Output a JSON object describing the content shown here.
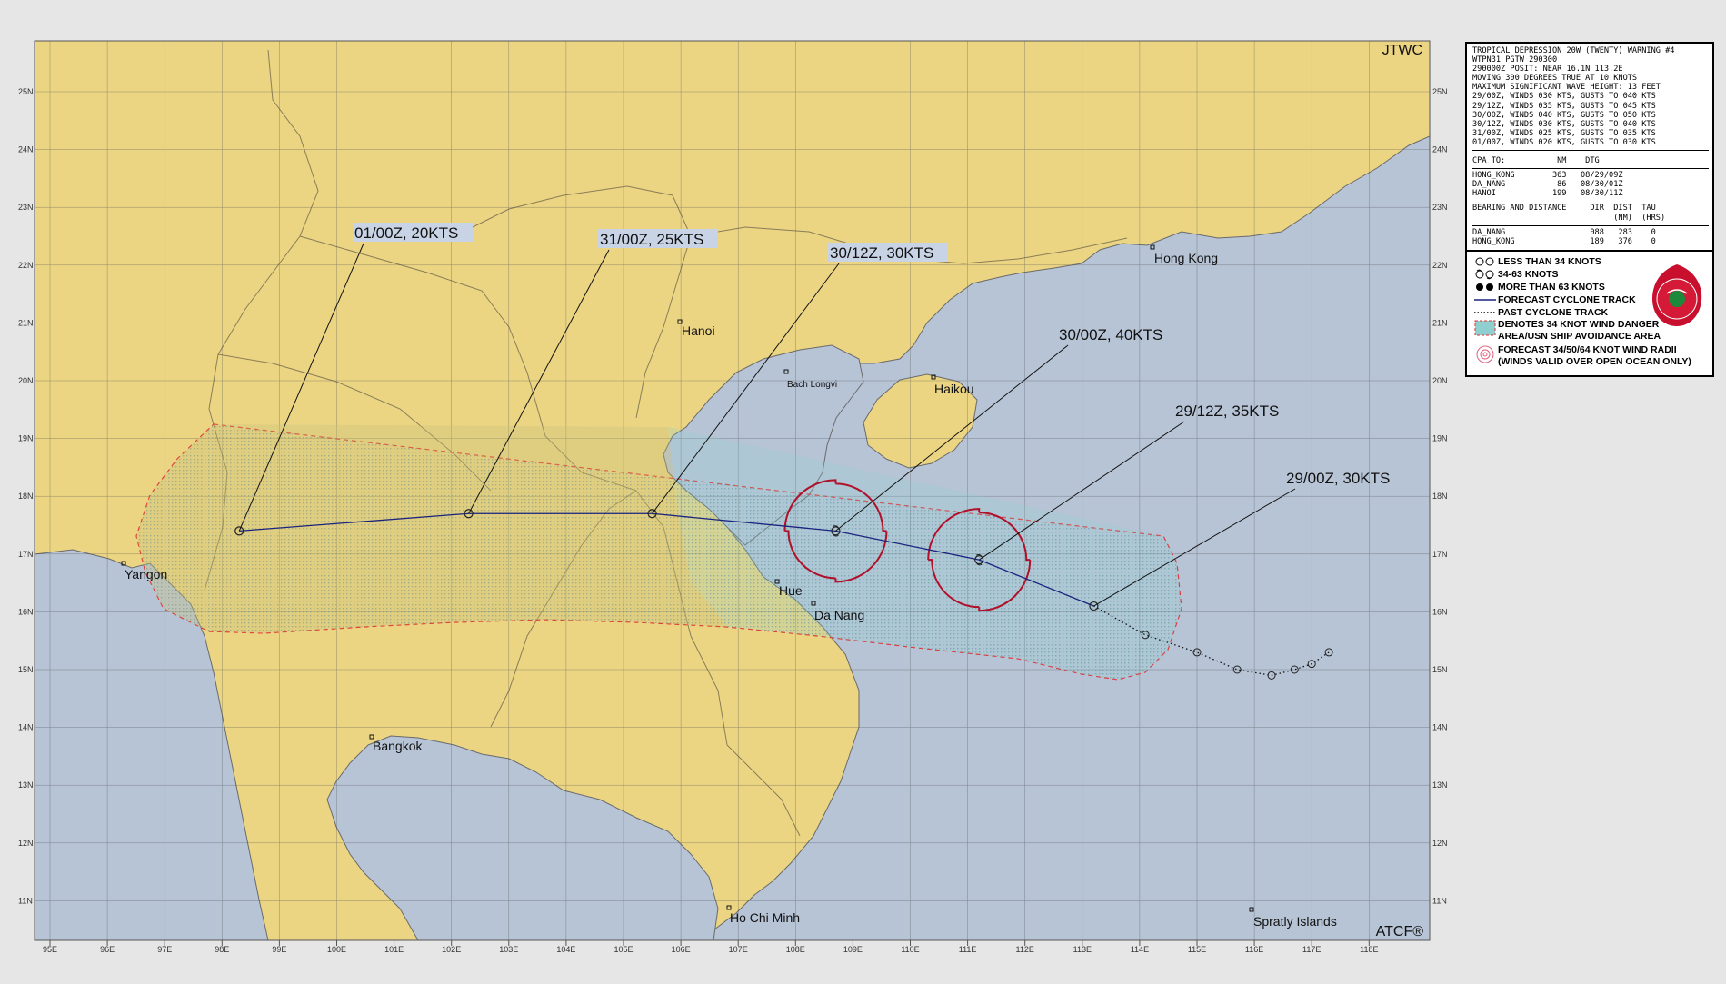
{
  "header": {
    "agency": "JTWC",
    "footer": "ATCF®"
  },
  "warning_text": {
    "lines": [
      "TROPICAL DEPRESSION 20W (TWENTY) WARNING #4",
      "WTPN31 PGTW 290300",
      "290000Z POSIT: NEAR 16.1N 113.2E",
      "MOVING 300 DEGREES TRUE AT 10 KNOTS",
      "MAXIMUM SIGNIFICANT WAVE HEIGHT: 13 FEET",
      "29/00Z, WINDS 030 KTS, GUSTS TO 040 KTS",
      "29/12Z, WINDS 035 KTS, GUSTS TO 045 KTS",
      "30/00Z, WINDS 040 KTS, GUSTS TO 050 KTS",
      "30/12Z, WINDS 030 KTS, GUSTS TO 040 KTS",
      "31/00Z, WINDS 025 KTS, GUSTS TO 035 KTS",
      "01/00Z, WINDS 020 KTS, GUSTS TO 030 KTS"
    ],
    "cpa_header": "CPA TO:           NM    DTG",
    "cpa_rows": [
      "HONG_KONG        363   08/29/09Z",
      "DA_NANG           86   08/30/01Z",
      "HANOI            199   08/30/11Z"
    ],
    "bd_header1": "BEARING AND DISTANCE     DIR  DIST  TAU",
    "bd_header2": "                              (NM)  (HRS)",
    "bd_rows": [
      "DA_NANG                  088   283    0",
      "HONG_KONG                189   376    0"
    ]
  },
  "legend": {
    "items": [
      "LESS THAN 34 KNOTS",
      "34-63 KNOTS",
      "MORE THAN 63 KNOTS",
      "FORECAST CYCLONE TRACK",
      "PAST CYCLONE TRACK",
      "DENOTES 34 KNOT WIND DANGER",
      "AREA/USN SHIP AVOIDANCE AREA",
      "FORECAST 34/50/64 KNOT WIND RADII",
      "(WINDS VALID OVER OPEN OCEAN ONLY)"
    ],
    "colors": {
      "track": "#1a237e",
      "danger_fill": "#8fcfcf",
      "danger_border": "#e03030",
      "radii": "#b0102a"
    }
  },
  "forecast_labels": [
    "29/00Z, 30KTS",
    "29/12Z, 35KTS",
    "30/00Z, 40KTS",
    "30/12Z, 30KTS",
    "31/00Z, 25KTS",
    "01/00Z, 20KTS"
  ],
  "track": {
    "forecast": [
      {
        "lon": 113.2,
        "lat": 16.1
      },
      {
        "lon": 111.2,
        "lat": 16.9
      },
      {
        "lon": 108.7,
        "lat": 17.4
      },
      {
        "lon": 105.5,
        "lat": 17.7
      },
      {
        "lon": 102.3,
        "lat": 17.7
      },
      {
        "lon": 98.3,
        "lat": 17.4
      }
    ],
    "past": [
      {
        "lon": 117.3,
        "lat": 15.3
      },
      {
        "lon": 117.0,
        "lat": 15.1
      },
      {
        "lon": 116.7,
        "lat": 15.0
      },
      {
        "lon": 116.3,
        "lat": 14.9
      },
      {
        "lon": 115.7,
        "lat": 15.0
      },
      {
        "lon": 115.0,
        "lat": 15.3
      },
      {
        "lon": 114.1,
        "lat": 15.6
      }
    ]
  },
  "places": [
    "Hong Kong",
    "Hanoi",
    "Bach Longvi",
    "Haikou",
    "Hue",
    "Da Nang",
    "Yangon",
    "Bangkok",
    "Ho Chi Minh",
    "Spratly Islands"
  ],
  "axes": {
    "lon_ticks": [
      "95E",
      "96E",
      "97E",
      "98E",
      "99E",
      "100E",
      "101E",
      "102E",
      "103E",
      "104E",
      "105E",
      "106E",
      "107E",
      "108E",
      "109E",
      "110E",
      "111E",
      "112E",
      "113E",
      "114E",
      "115E",
      "116E",
      "117E",
      "118E"
    ],
    "lat_ticks": [
      "11N",
      "12N",
      "13N",
      "14N",
      "15N",
      "16N",
      "17N",
      "18N",
      "19N",
      "20N",
      "21N",
      "22N",
      "23N",
      "24N",
      "25N"
    ]
  }
}
